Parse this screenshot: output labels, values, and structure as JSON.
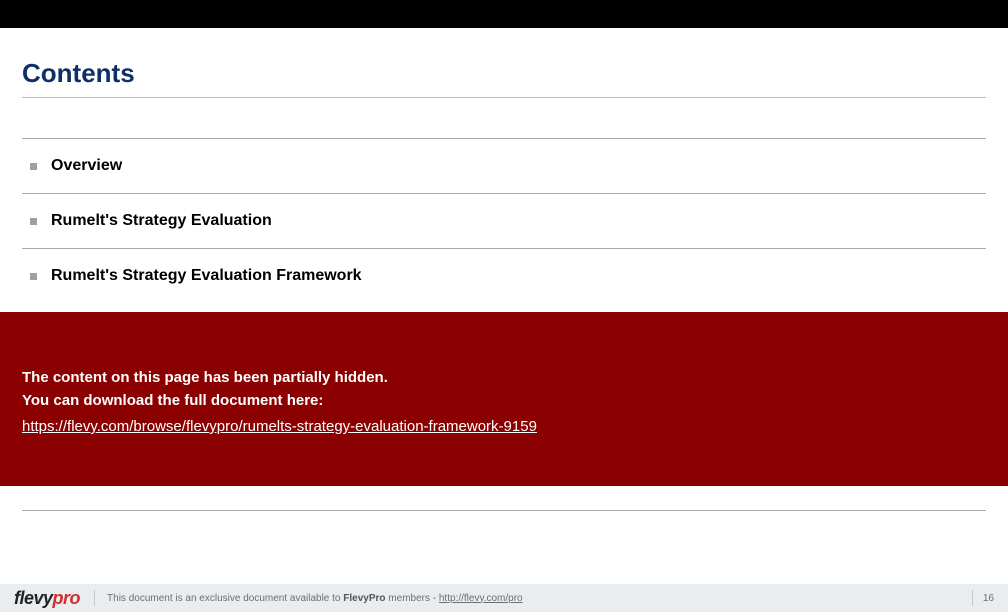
{
  "title": "Contents",
  "toc": {
    "items": [
      {
        "label": "Overview"
      },
      {
        "label": "Rumelt's Strategy Evaluation"
      },
      {
        "label": "Rumelt's Strategy Evaluation Framework"
      }
    ]
  },
  "hidden_notice": {
    "line1": "The content on this page has been partially hidden.",
    "line2": "You can download the full document here:",
    "url": "https://flevy.com/browse/flevypro/rumelts-strategy-evaluation-framework-9159"
  },
  "footer": {
    "logo_part1": "flevy",
    "logo_part2": "pro",
    "text_before": "This document is an exclusive document available to ",
    "text_brand": "FlevyPro",
    "text_after": " members - ",
    "link_text": "http://flevy.com/pro",
    "page_number": "16"
  }
}
